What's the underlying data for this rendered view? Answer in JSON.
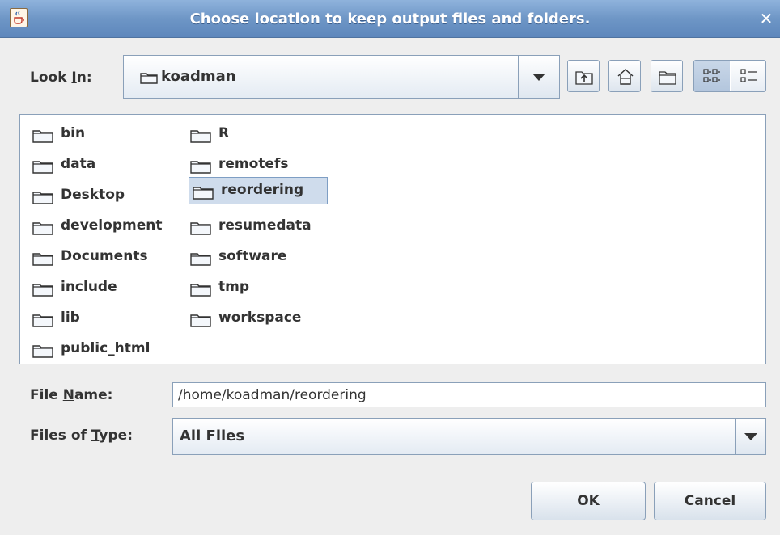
{
  "dialog": {
    "title": "Choose location to keep output files and folders.",
    "close_glyph": "✕"
  },
  "look_in": {
    "label_before": "Look ",
    "label_mnemonic": "I",
    "label_after": "n:",
    "value": "koadman"
  },
  "files": [
    {
      "name": "bin",
      "selected": false
    },
    {
      "name": "data",
      "selected": false
    },
    {
      "name": "Desktop",
      "selected": false
    },
    {
      "name": "development",
      "selected": false
    },
    {
      "name": "Documents",
      "selected": false
    },
    {
      "name": "include",
      "selected": false
    },
    {
      "name": "lib",
      "selected": false
    },
    {
      "name": "public_html",
      "selected": false
    },
    {
      "name": "R",
      "selected": false
    },
    {
      "name": "remotefs",
      "selected": false
    },
    {
      "name": "reordering",
      "selected": true
    },
    {
      "name": "resumedata",
      "selected": false
    },
    {
      "name": "software",
      "selected": false
    },
    {
      "name": "tmp",
      "selected": false
    },
    {
      "name": "workspace",
      "selected": false
    }
  ],
  "file_name": {
    "label_before": "File ",
    "label_mnemonic": "N",
    "label_after": "ame:",
    "value": "/home/koadman/reordering"
  },
  "file_type": {
    "label_before": "Files of ",
    "label_mnemonic": "T",
    "label_after": "ype:",
    "value": "All Files"
  },
  "buttons": {
    "ok": "OK",
    "cancel": "Cancel"
  },
  "icons": {
    "app": "java-cup-icon",
    "up": "up-folder-icon",
    "home": "home-icon",
    "new_folder": "new-folder-icon",
    "list_view": "list-view-icon",
    "details_view": "details-view-icon",
    "folder": "folder-icon"
  },
  "colors": {
    "titlebar": "#6e96c6",
    "selection": "#cfdcec",
    "border": "#8aa0b9"
  }
}
